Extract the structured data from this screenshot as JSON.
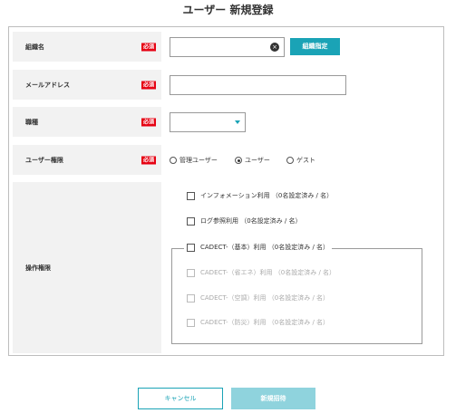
{
  "page": {
    "title": "ユーザー 新規登録"
  },
  "required_badge": "必須",
  "fields": {
    "organization": {
      "label": "組織名",
      "value": "",
      "button": "組織指定"
    },
    "email": {
      "label": "メールアドレス",
      "value": ""
    },
    "position": {
      "label": "職種",
      "selected": ""
    },
    "user_role": {
      "label": "ユーザー権限",
      "options": [
        "管理ユーザー",
        "ユーザー",
        "ゲスト"
      ],
      "selected": "ユーザー"
    },
    "permissions": {
      "label": "操作権限",
      "items": [
        "インフォメーション利用 （0名設定済み / 名）",
        "ログ参照利用 （0名設定済み / 名）",
        "CADECT-（基本）利用 （0名設定済み / 名）",
        "CADECT-（省エネ）利用 （0名設定済み / 名）",
        "CADECT-（空調）利用 （0名設定済み / 名）",
        "CADECT-（防災）利用 （0名設定済み / 名）"
      ]
    }
  },
  "footer": {
    "cancel": "キャンセル",
    "submit": "新規招待"
  },
  "colors": {
    "accent": "#1aa3b6",
    "required": "#e60012",
    "label_bg": "#f2f2f2"
  }
}
